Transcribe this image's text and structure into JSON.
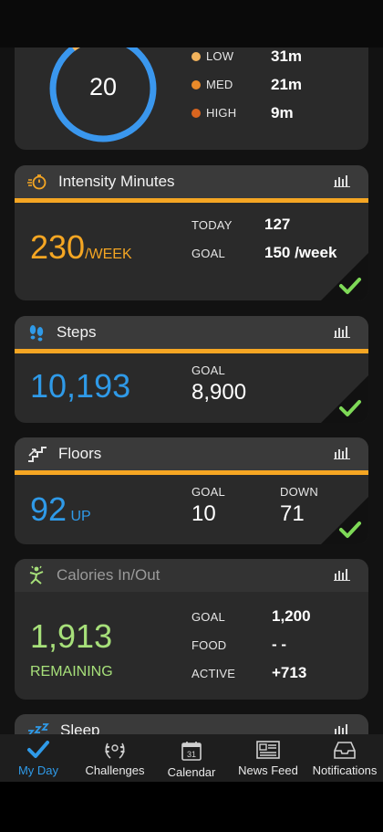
{
  "heart_card": {
    "ring_value": "20",
    "rows": [
      {
        "label": "LOW",
        "value": "31m",
        "color": "#f2b35c"
      },
      {
        "label": "MED",
        "value": "21m",
        "color": "#e98a2a"
      },
      {
        "label": "HIGH",
        "value": "9m",
        "color": "#d9651f"
      }
    ]
  },
  "intensity": {
    "title": "Intensity Minutes",
    "big_value": "230",
    "big_unit": "/WEEK",
    "today_label": "TODAY",
    "today_value": "127",
    "goal_label": "GOAL",
    "goal_value": "150 /week"
  },
  "steps": {
    "title": "Steps",
    "big_value": "10,193",
    "goal_label": "GOAL",
    "goal_value": "8,900"
  },
  "floors": {
    "title": "Floors",
    "big_value": "92",
    "big_unit": "UP",
    "goal_label": "GOAL",
    "goal_value": "10",
    "down_label": "DOWN",
    "down_value": "71"
  },
  "calories": {
    "title": "Calories In/Out",
    "big_value": "1,913",
    "remaining_label": "REMAINING",
    "goal_label": "GOAL",
    "goal_value": "1,200",
    "food_label": "FOOD",
    "food_value": "- -",
    "active_label": "ACTIVE",
    "active_value": "+713"
  },
  "sleep": {
    "title": "Sleep"
  },
  "tabs": [
    {
      "label": "My Day",
      "icon": "check-icon",
      "active": true
    },
    {
      "label": "Challenges",
      "icon": "laurel-icon",
      "active": false
    },
    {
      "label": "Calendar",
      "icon": "calendar-icon",
      "active": false,
      "calendar_day": "31"
    },
    {
      "label": "News Feed",
      "icon": "newspaper-icon",
      "active": false
    },
    {
      "label": "Notifications",
      "icon": "inbox-icon",
      "active": false
    }
  ],
  "colors": {
    "accent_orange": "#f5a623",
    "steps_blue": "#2f9ae8",
    "calories_green": "#a7e07a",
    "check_green": "#7ed957"
  }
}
